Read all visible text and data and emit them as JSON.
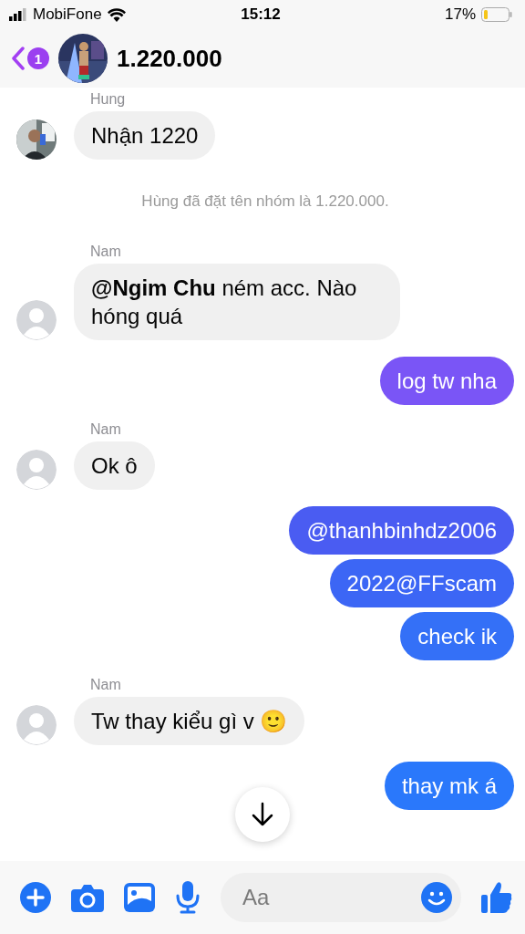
{
  "status_bar": {
    "carrier": "MobiFone",
    "time": "15:12",
    "battery": "17%"
  },
  "header": {
    "back_badge": "1",
    "title": "1.220.000"
  },
  "messages": [
    {
      "kind": "incoming",
      "sender": "Hung",
      "texts": [
        "Nhận 1220"
      ]
    },
    {
      "kind": "system",
      "text": "Hùng đã đặt tên nhóm là 1.220.000."
    },
    {
      "kind": "incoming",
      "sender": "Nam",
      "avatar": {
        "kind": "default"
      },
      "texts": [
        "**@Ngim Chu**  ném acc. Nào hóng quá"
      ]
    },
    {
      "kind": "outgoing",
      "bubbles": [
        {
          "text": "log tw nha",
          "color": "#7a55f6"
        }
      ]
    },
    {
      "kind": "incoming",
      "sender": "Nam",
      "avatar": {
        "kind": "default"
      },
      "texts": [
        "Ok ô"
      ]
    },
    {
      "kind": "outgoing",
      "bubbles": [
        {
          "text": "@thanhbinhdz2006",
          "color": "#4a5cf2"
        },
        {
          "text": "2022@FFscam",
          "color": "#3c66f5"
        },
        {
          "text": "check ik",
          "color": "#3470f7"
        }
      ]
    },
    {
      "kind": "incoming",
      "sender": "Nam",
      "avatar": {
        "kind": "default"
      },
      "texts": [
        "Tw thay kiểu gì v 🙂"
      ]
    },
    {
      "kind": "outgoing",
      "bubbles": [
        {
          "text": "thay mk á",
          "color": "#2a78fb"
        }
      ]
    }
  ],
  "composer": {
    "placeholder": "Aa"
  }
}
